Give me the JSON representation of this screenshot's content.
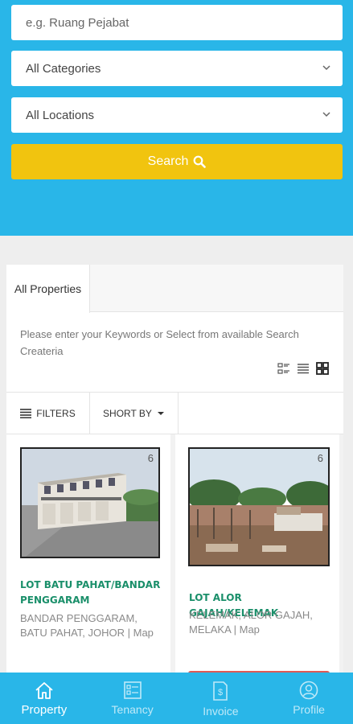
{
  "search": {
    "placeholder": "e.g. Ruang Pejabat",
    "category_value": "All Categories",
    "location_value": "All Locations",
    "button_label": "Search"
  },
  "tabs": {
    "active_label": "All Properties"
  },
  "hint_text": "Please enter your Keywords or Select from available Search Createria",
  "toolbar": {
    "filters_label": "FILTERS",
    "sort_label": "SHORT BY"
  },
  "listings": [
    {
      "title": "LOT BATU PAHAT/BANDAR PENGGARAM",
      "address": "BANDAR PENGGARAM, BATU PAHAT, JOHOR | Map",
      "photo_count": "6"
    },
    {
      "title": "LOT ALOR GAJAH/KELEMAK",
      "address": "KELEMAK, ALOR GAJAH, MELAKA | Map",
      "photo_count": "6"
    }
  ],
  "bottom_nav": [
    {
      "label": "Property",
      "icon": "home-icon",
      "active": true
    },
    {
      "label": "Tenancy",
      "icon": "tenancy-list-icon",
      "active": false
    },
    {
      "label": "Invoice",
      "icon": "invoice-icon",
      "active": false
    },
    {
      "label": "Profile",
      "icon": "profile-icon",
      "active": false
    }
  ],
  "colors": {
    "primary_blue": "#29b6e8",
    "search_yellow": "#f1c40f",
    "title_green": "#1a8f6a"
  }
}
